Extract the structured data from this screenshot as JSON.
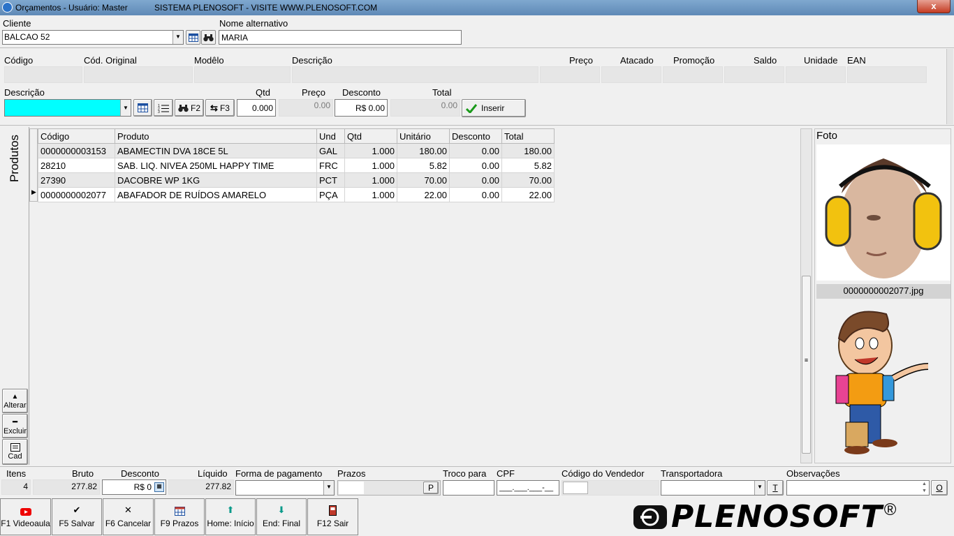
{
  "window": {
    "title": "Orçamentos - Usuário: Master",
    "system_title": "SISTEMA PLENOSOFT - VISITE WWW.PLENOSOFT.COM",
    "close_label": "x"
  },
  "cliente": {
    "label": "Cliente",
    "value": "BALCAO 52",
    "alt_name_label": "Nome alternativo",
    "alt_name_value": "MARIA"
  },
  "product_info": {
    "headers": [
      "Código",
      "Cód. Original",
      "Modêlo",
      "Descrição",
      "Preço",
      "Atacado",
      "Promoção",
      "Saldo",
      "Unidade",
      "EAN"
    ]
  },
  "entry": {
    "descricao_label": "Descrição",
    "descricao_value": "",
    "f2_label": "F2",
    "f3_label": "F3",
    "qtd_label": "Qtd",
    "qtd_value": "0.000",
    "preco_label": "Preço",
    "preco_value": "0.00",
    "desconto_label": "Desconto",
    "desconto_value": "R$ 0.00",
    "total_label": "Total",
    "total_value": "0.00",
    "inserir_label": "Inserir"
  },
  "side_tab": {
    "label": "Produtos",
    "alterar": "Alterar",
    "excluir": "Excluir",
    "cad": "Cad"
  },
  "grid": {
    "columns": [
      "Código",
      "Produto",
      "Und",
      "Qtd",
      "Unitário",
      "Desconto",
      "Total"
    ],
    "rows": [
      [
        "0000000003153",
        "ABAMECTIN DVA 18CE 5L",
        "GAL",
        "1.000",
        "180.00",
        "0.00",
        "180.00"
      ],
      [
        "28210",
        "SAB. LIQ. NIVEA 250ML HAPPY TIME",
        "FRC",
        "1.000",
        "5.82",
        "0.00",
        "5.82"
      ],
      [
        "27390",
        "DACOBRE WP 1KG",
        "PCT",
        "1.000",
        "70.00",
        "0.00",
        "70.00"
      ],
      [
        "0000000002077",
        "ABAFADOR DE RUÍDOS AMARELO",
        "PÇA",
        "1.000",
        "22.00",
        "0.00",
        "22.00"
      ]
    ]
  },
  "photo": {
    "label": "Foto",
    "filename": "0000000002077.jpg"
  },
  "totals": {
    "itens_label": "Itens",
    "itens_value": "4",
    "bruto_label": "Bruto",
    "bruto_value": "277.82",
    "desconto_label": "Desconto",
    "desconto_value": "R$ 0",
    "liquido_label": "Líquido",
    "liquido_value": "277.82",
    "forma_label": "Forma de pagamento",
    "prazos_label": "Prazos",
    "prazos_btn": "P",
    "troco_label": "Troco para",
    "cpf_label": "CPF",
    "cpf_value": "___.___.___-__",
    "vendedor_label": "Código do Vendedor",
    "transportadora_label": "Transportadora",
    "transp_btn": "T",
    "obs_label": "Observações",
    "obs_btn": "O"
  },
  "fkeys": [
    {
      "label": "F1 Videoaula",
      "icon": "youtube-icon"
    },
    {
      "label": "F5 Salvar",
      "icon": "check-icon"
    },
    {
      "label": "F6 Cancelar",
      "icon": "x-icon"
    },
    {
      "label": "F9 Prazos",
      "icon": "calendar-icon"
    },
    {
      "label": "Home: Início",
      "icon": "arrow-up-icon"
    },
    {
      "label": "End: Final",
      "icon": "arrow-down-icon"
    },
    {
      "label": "F12 Sair",
      "icon": "exit-door-icon"
    }
  ],
  "brand": {
    "logo_text": "PLENOSOFT",
    "registered": "®"
  },
  "colors": {
    "accent_input": "#00ffff",
    "titlebar": "#6f97c2",
    "close": "#c9432b"
  }
}
